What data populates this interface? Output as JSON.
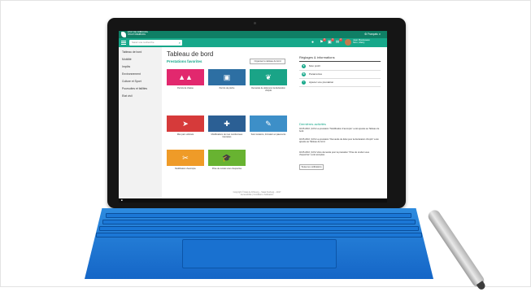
{
  "header": {
    "logo_line1": "ÉTAT DE FRIBOURG",
    "logo_line2": "STAAT FREIBURG",
    "language": "⚙ Français ∨",
    "user_name": "Jean Bouleseau",
    "user_sub": "Sinn, Marly"
  },
  "search": {
    "placeholder": "Saisir une recherche"
  },
  "notifications": {
    "badge1": "8",
    "badge2": "3",
    "badge3": "2"
  },
  "sidebar": {
    "items": [
      {
        "label": "Tableau de bord"
      },
      {
        "label": "Mobilité"
      },
      {
        "label": "Impôts"
      },
      {
        "label": "Environnement"
      },
      {
        "label": "Culture et Sport"
      },
      {
        "label": "Poursuites et faillites"
      },
      {
        "label": "Etat civil"
      }
    ]
  },
  "main": {
    "title": "Tableau de bord",
    "favorites_title": "Prestations favorites",
    "organize_button": "Organiser le tableau de bord",
    "tiles": [
      {
        "label": "Permis de chasse",
        "color": "#e2286e"
      },
      {
        "label": "Permis de pêche",
        "color": "#2d6fa3"
      },
      {
        "label": "Demande de délai pour la déclaration d'impôt",
        "color": "#1aa487"
      },
      {
        "label": "Mon parc véhiculé",
        "color": "#d63a3a"
      },
      {
        "label": "Modifications de mes coordonnées bancaires",
        "color": "#2b5f94"
      },
      {
        "label": "Suivi locations, formation et paiements",
        "color": "#3d8fc8"
      },
      {
        "label": "Modification d'acompte",
        "color": "#ef9b28"
      },
      {
        "label": "Prise de rendez-vous d'expertise",
        "color": "#68b331"
      }
    ]
  },
  "panel": {
    "settings_title": "Réglages & informations",
    "items": [
      {
        "label": "Mon profil",
        "icon": "user-icon"
      },
      {
        "label": "Paramètres",
        "icon": "gear-icon"
      },
      {
        "label": "Ajouter une prestation",
        "icon": "plus-icon"
      }
    ],
    "activities_title": "Dernières activités",
    "activities": [
      "02.05.2016 | 10h1 La prestation \"Modification d'acompte\" a été ajoutée au Tableau de bord.",
      "02.05.2016 | 10h1 La prestation \"Demande de délai pour la déclaration d'impôt\" a été ajoutée au Tableau de bord.",
      "02.05.2016 | 10h1 Votre demande pour la prestation \"Prise de rendez-vous d'expertise\" a été acceptée."
    ],
    "notifications_button": "Toutes les notifications"
  },
  "footer": {
    "line1": "Copyright © Etat de Fribourg – Staat Freiburg – 2017",
    "line2": "Accessibilité | Conditions d'utilisation"
  }
}
